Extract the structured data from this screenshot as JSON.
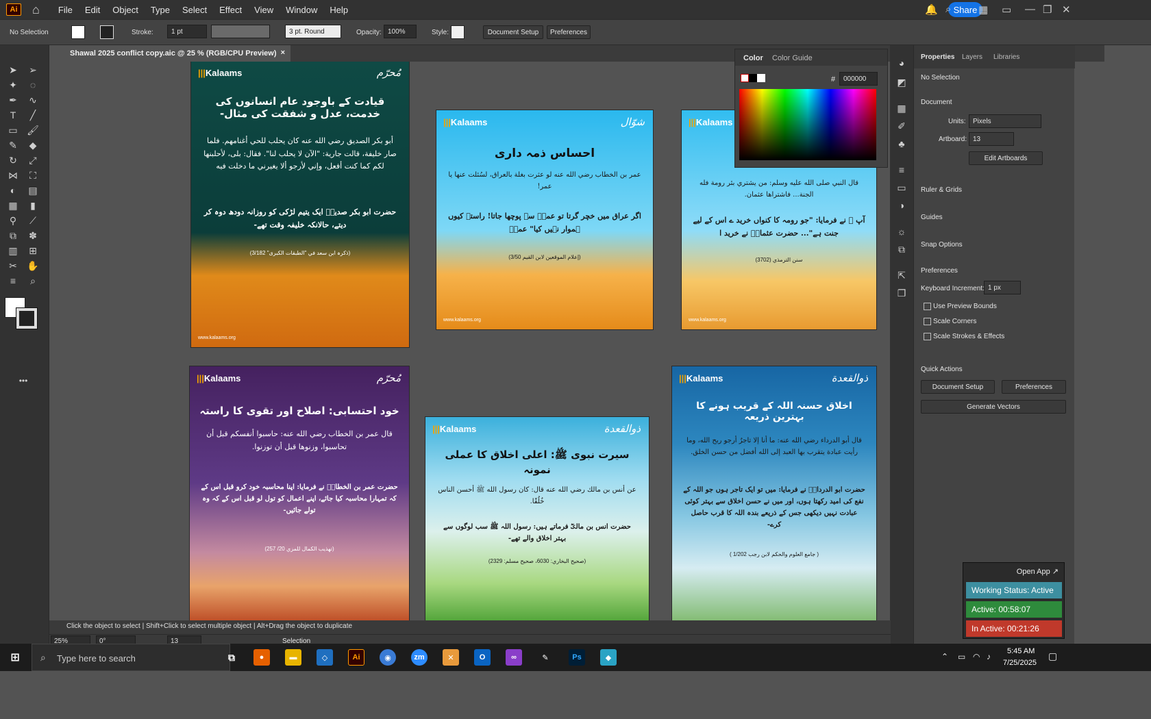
{
  "app": {
    "logo": "Ai",
    "menus": [
      "File",
      "Edit",
      "Object",
      "Type",
      "Select",
      "Effect",
      "View",
      "Window",
      "Help"
    ],
    "share": "Share"
  },
  "control": {
    "selection": "No Selection",
    "stroke_label": "Stroke:",
    "stroke_value": "1 pt",
    "brush": "3 pt. Round",
    "opacity_label": "Opacity:",
    "opacity_value": "100%",
    "style_label": "Style:",
    "doc_setup": "Document Setup",
    "preferences": "Preferences"
  },
  "tab": {
    "title": "Shawal 2025 conflict copy.aic @ 25 % (RGB/CPU Preview)",
    "close": "×"
  },
  "cards": [
    {
      "brand": "Kalaams",
      "seal": "مُحرّم",
      "title": "قیادت کے باوجود عام انسانوں کی خدمت، عدل و شفقت کی مثال-",
      "arabic": "أبو بكر الصديق رضي الله عنه كان يحلب للحي أغنامهم. فلما صار خليفة، قالت جارية: \"الآن لا يحلب لنا\". فقال: بلى، لأحلبنها لكم كما كنت أفعل، وإني لأرجو ألا يغيرني ما دخلت فيه",
      "urdu": "حضرت ابو بکر صدیقؓ ایک یتیم لڑکی کو روزانہ دودھ دوہ کر دیتے، حالانکہ خلیفہ وقت تھے-",
      "ref": "(ذکرہ ابن سعد في \"الطبقات الکبری\" 3/182)",
      "site": "www.kalaams.org"
    },
    {
      "brand": "Kalaams",
      "seal": "شوّال",
      "title": "احساس ذمہ داری",
      "arabic": "عمر بن الخطاب رضي الله عنه لو عثرت بغلة بالعراق، لسُئلت عنها يا عمر!",
      "urdu": "اگر عراق میں خچر گرتا تو عمرؓ سے پوچھا جاتا! راستہ کیوں ہموار نہیں کیا\" عمرؓ",
      "ref": "(إعلام الموقعين لابن القيم 3/50)",
      "site": "www.kalaams.org"
    },
    {
      "brand": "Kalaams",
      "seal": "",
      "title": "",
      "arabic": "قال النبي صلى الله عليه وسلم: من يشتري بئر رومة فله الجنة... فاشتراها عثمان.",
      "urdu": "آپ ﷺ نے فرمایا: \"جو رومہ کا کنواں خرید ے اس کے لیے جنت ہے\"... حضرت عثمانؓ نے خرید ا",
      "ref": "سنن الترمذي (3702)",
      "site": "www.kalaams.org"
    },
    {
      "brand": "Kalaams",
      "seal": "مُحرّم",
      "title": "خود احتسابی: اصلاح اور تقوی کا راستہ",
      "arabic": "قال عمر بن الخطاب رضي الله عنه: حاسبوا أنفسكم قبل أن تحاسبوا، وزنوها قبل أن توزنوا.",
      "urdu": "حضرت عمر بن الخطابؓ نے فرمایا: اپنا محاسبہ خود کرو قبل اس کے کہ تمہارا محاسبہ کیا جائے، اپنے اعمال کو تول لو قبل اس کے کہ وہ تولے جائیں-",
      "ref": "(تهذيب الكمال للمزي 20/ 257)",
      "site": ""
    },
    {
      "brand": "Kalaams",
      "seal": "ذوالقعدة",
      "title": "سیرت نبوی ﷺ: اعلی اخلاق کا عملی نمونہ",
      "arabic": "عن أنس بن مالك رضي الله عنه قال: كان رسول الله ﷺ أحسن الناس خُلُقًا.",
      "urdu": "حضرت انس بن مالکؓ فرماتے ہیں: رسول اللہ ﷺ سب لوگوں سے بہتر اخلاق والے تھے-",
      "ref": "(صحيح البخاري: 6030، صحيح مسلم: 2329)",
      "site": ""
    },
    {
      "brand": "Kalaams",
      "seal": "ذوالقعدة",
      "title": "اخلاق حسنہ اللہ کے قریب ہونے کا بہترین ذریعہ",
      "arabic": "قال أبو الدرداء رضي الله عنه: ما أنا إلا تاجرٌ أرجو ربح الله، وما رأيت عبادة يتقرب بها العبد إلى الله أفضل من حسن الخلق.",
      "urdu": "حضرت ابو الدرداءؓ نے فرمایا: میں تو ایک تاجر ہوں جو اللہ کے نفع کی امید رکھتا ہوں، اور میں نے حسن اخلاق سے بہتر کوئی عبادت نہیں دیکھی جس کے ذریعے بندہ اللہ کا قرب حاصل کرے-",
      "ref": "( جامع العلوم والحكم لابن رجب 1/202 )",
      "site": ""
    }
  ],
  "color_panel": {
    "tab1": "Color",
    "tab2": "Color Guide",
    "hex_label": "#",
    "hex": "000000"
  },
  "props": {
    "tabs": [
      "Properties",
      "Layers",
      "Libraries"
    ],
    "selection": "No Selection",
    "document": "Document",
    "units_label": "Units:",
    "units": "Pixels",
    "artboard_label": "Artboard:",
    "artboard": "13",
    "edit_artboards": "Edit Artboards",
    "ruler": "Ruler & Grids",
    "guides": "Guides",
    "snap": "Snap Options",
    "preferences": "Preferences",
    "kbd_label": "Keyboard Increment:",
    "kbd": "1 px",
    "cb1": "Use Preview Bounds",
    "cb2": "Scale Corners",
    "cb3": "Scale Strokes & Effects",
    "quick": "Quick Actions",
    "doc_setup": "Document Setup",
    "prefs_btn": "Preferences",
    "gen_vectors": "Generate Vectors"
  },
  "status": {
    "hint": "Click the object to select  |  Shift+Click to select multiple object  |  Alt+Drag the object to duplicate",
    "zoom": "25%",
    "angle": "0°",
    "artboard": "13",
    "mode": "Selection"
  },
  "tracker": {
    "open": "Open App ↗",
    "working": "Working Status: Active",
    "active": "Active: 00:58:07",
    "inactive": "In Active: 00:21:26"
  },
  "taskbar": {
    "search": "Type here to search",
    "time": "5:45 AM",
    "date": "7/25/2025"
  }
}
